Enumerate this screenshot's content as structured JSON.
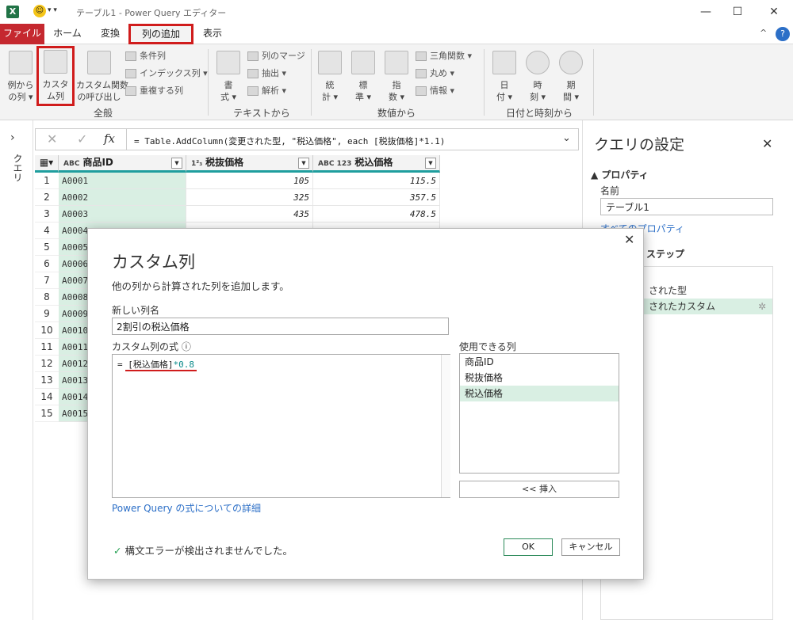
{
  "titlebar": {
    "app_icon": "X",
    "title": "テーブル1 - Power Query エディター",
    "minimize": "—",
    "maximize": "☐",
    "close": "✕"
  },
  "tabs": {
    "file": "ファイル",
    "home": "ホーム",
    "transform": "変換",
    "add_column": "列の追加",
    "view": "表示"
  },
  "ribbon": {
    "general": {
      "label": "全般",
      "example": "例から\nの列 ▾",
      "custom": "カスタ\nム列",
      "invoke": "カスタム関数\nの呼び出し",
      "conditional": "条件列",
      "index": "インデックス列 ▾",
      "duplicate": "重複する列"
    },
    "text": {
      "label": "テキストから",
      "format": "書\n式 ▾",
      "merge": "列のマージ",
      "extract": "抽出 ▾",
      "parse": "解析 ▾"
    },
    "number": {
      "label": "数値から",
      "stats": "統\n計 ▾",
      "standard": "標\n準 ▾",
      "scientific": "指\n数 ▾",
      "trig": "三角関数 ▾",
      "rounding": "丸め ▾",
      "info": "情報 ▾"
    },
    "datetime": {
      "label": "日付と時刻から",
      "date": "日\n付 ▾",
      "time": "時\n刻 ▾",
      "duration": "期\n間 ▾"
    }
  },
  "left_strip": {
    "label": "クエリ"
  },
  "formula_bar": {
    "text": "= Table.AddColumn(変更された型, \"税込価格\", each [税抜価格]*1.1)"
  },
  "grid": {
    "columns": [
      {
        "type": "ABC",
        "name": "商品ID"
      },
      {
        "type": "1²₃",
        "name": "税抜価格"
      },
      {
        "type": "ABC 123",
        "name": "税込価格"
      }
    ],
    "rows": [
      {
        "n": "1",
        "id": "A0001",
        "p": "105",
        "t": "115.5"
      },
      {
        "n": "2",
        "id": "A0002",
        "p": "325",
        "t": "357.5"
      },
      {
        "n": "3",
        "id": "A0003",
        "p": "435",
        "t": "478.5"
      },
      {
        "n": "4",
        "id": "A0004",
        "p": "",
        "t": ""
      },
      {
        "n": "5",
        "id": "A0005",
        "p": "",
        "t": ""
      },
      {
        "n": "6",
        "id": "A0006",
        "p": "",
        "t": ""
      },
      {
        "n": "7",
        "id": "A0007",
        "p": "",
        "t": ""
      },
      {
        "n": "8",
        "id": "A0008",
        "p": "",
        "t": ""
      },
      {
        "n": "9",
        "id": "A0009",
        "p": "",
        "t": ""
      },
      {
        "n": "10",
        "id": "A0010",
        "p": "",
        "t": ""
      },
      {
        "n": "11",
        "id": "A0011",
        "p": "",
        "t": ""
      },
      {
        "n": "12",
        "id": "A0012",
        "p": "",
        "t": ""
      },
      {
        "n": "13",
        "id": "A0013",
        "p": "",
        "t": ""
      },
      {
        "n": "14",
        "id": "A0014",
        "p": "",
        "t": ""
      },
      {
        "n": "15",
        "id": "A0015",
        "p": "",
        "t": ""
      }
    ]
  },
  "query_settings": {
    "title": "クエリの設定",
    "close": "✕",
    "properties": "▲ プロパティ",
    "name_label": "名前",
    "name_value": "テーブル1",
    "all_props": "すべてのプロパティ",
    "applied_steps": "ステップ",
    "steps": [
      "ス",
      "された型",
      "されたカスタム"
    ]
  },
  "dialog": {
    "close": "✕",
    "title": "カスタム列",
    "subtitle": "他の列から計算された列を追加します。",
    "new_col_label": "新しい列名",
    "new_col_value": "2割引の税込価格",
    "formula_label": "カスタム列の式 ⓘ",
    "formula_prefix": "= ",
    "formula_ref": "[税込価格]",
    "formula_op": "*0.8",
    "available_label": "使用できる列",
    "available": [
      "商品ID",
      "税抜価格",
      "税込価格"
    ],
    "insert": "<< 挿入",
    "more_link": "Power Query の式についての詳細",
    "status": "構文エラーが検出されませんでした。",
    "ok": "OK",
    "cancel": "キャンセル"
  }
}
